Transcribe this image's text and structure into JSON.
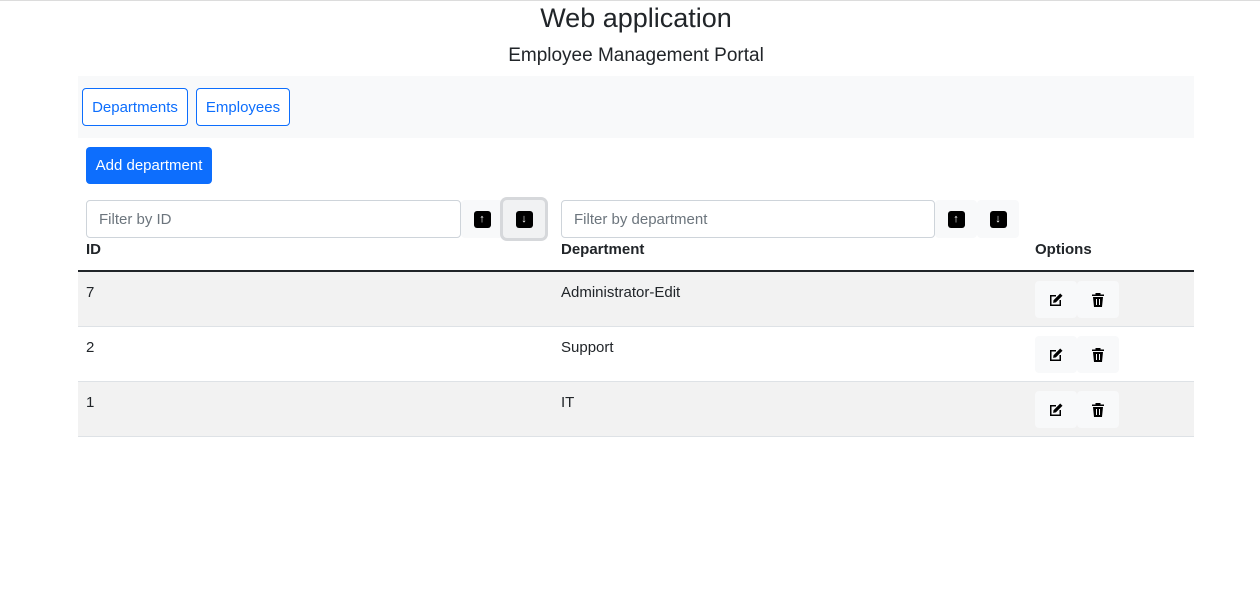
{
  "header": {
    "title": "Web application",
    "subtitle": "Employee Management Portal"
  },
  "nav": {
    "departments_label": "Departments",
    "employees_label": "Employees"
  },
  "actions": {
    "add_department_label": "Add department"
  },
  "filters": {
    "id_placeholder": "Filter by ID",
    "id_value": "",
    "department_placeholder": "Filter by department",
    "department_value": ""
  },
  "table": {
    "columns": [
      "ID",
      "Department",
      "Options"
    ],
    "rows": [
      {
        "id": "7",
        "department": "Administrator-Edit"
      },
      {
        "id": "2",
        "department": "Support"
      },
      {
        "id": "1",
        "department": "IT"
      }
    ]
  },
  "icons": {
    "sort_asc": "arrow-up-icon",
    "sort_desc": "arrow-down-icon",
    "edit": "edit-icon",
    "delete": "trash-icon"
  },
  "colors": {
    "primary": "#0d6efd",
    "navbar_bg": "#f8f9fa",
    "striped_row": "#f2f2f2"
  }
}
